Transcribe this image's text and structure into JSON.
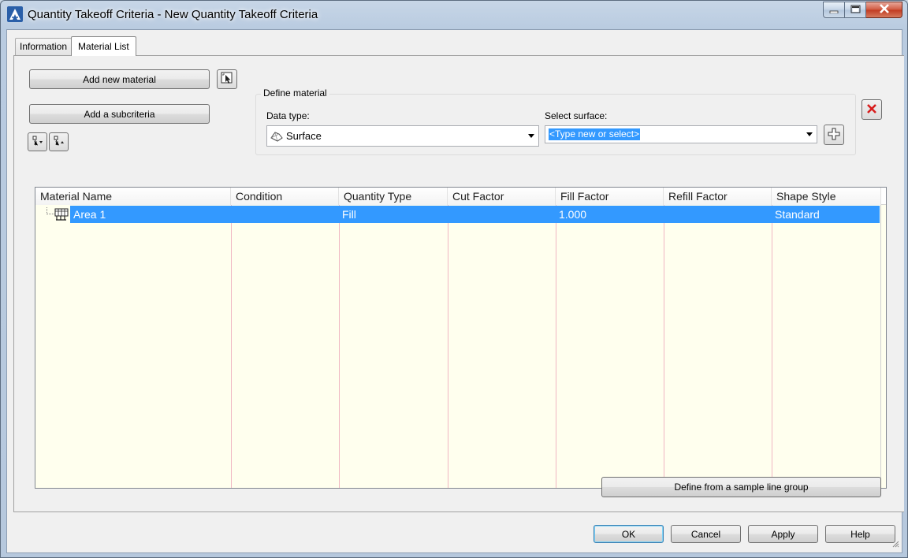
{
  "window": {
    "title": "Quantity Takeoff Criteria - New Quantity Takeoff Criteria"
  },
  "tabs": [
    {
      "label": "Information",
      "active": false
    },
    {
      "label": "Material List",
      "active": true
    }
  ],
  "toolbar": {
    "add_material_label": "Add new material",
    "add_subcriteria_label": "Add a subcriteria"
  },
  "define_material": {
    "legend": "Define material",
    "data_type_label": "Data type:",
    "data_type_value": "Surface",
    "select_surface_label": "Select surface:",
    "select_surface_value": "<Type new or select>"
  },
  "table": {
    "columns": [
      "Material Name",
      "Condition",
      "Quantity Type",
      "Cut Factor",
      "Fill Factor",
      "Refill Factor",
      "Shape Style"
    ],
    "rows": [
      {
        "material_name": "Area 1",
        "condition": "",
        "quantity_type": "Fill",
        "cut_factor": "",
        "fill_factor": "1.000",
        "refill_factor": "",
        "shape_style": "Standard"
      }
    ]
  },
  "define_from_sample_label": "Define from a sample line group",
  "footer": {
    "ok_label": "OK",
    "cancel_label": "Cancel",
    "apply_label": "Apply",
    "help_label": "Help"
  },
  "colors": {
    "selection": "#3399ff",
    "grid_background": "#ffffee",
    "grid_lines": "#f0b6c2"
  },
  "icons": {
    "app": "civil3d-logo-icon",
    "pick": "pick-from-drawing-icon",
    "expand": "expand-tree-icon",
    "collapse": "collapse-tree-icon",
    "surface": "surface-icon",
    "add": "plus-icon",
    "delete": "delete-x-icon",
    "material": "material-icon"
  }
}
